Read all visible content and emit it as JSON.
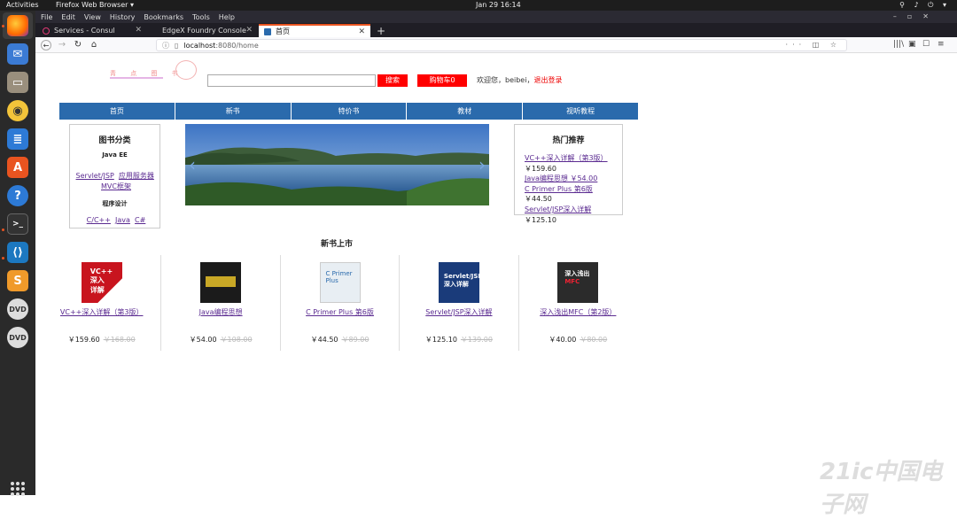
{
  "topbar": {
    "activities": "Activities",
    "app": "Firefox Web Browser ▾",
    "clock": "Jan 29  16:14",
    "system": "⚲ ♪ ⏻ ▾"
  },
  "menubar": [
    "File",
    "Edit",
    "View",
    "History",
    "Bookmarks",
    "Tools",
    "Help"
  ],
  "tabs": [
    {
      "label": "Services - Consul",
      "fav_color": "#e03875"
    },
    {
      "label": "EdgeX Foundry Console",
      "fav_color": "#888888"
    },
    {
      "label": "首页",
      "fav_color": "#2a6aac",
      "active": true
    }
  ],
  "url": {
    "host": "localhost",
    "path": ":8080/home"
  },
  "header": {
    "logo_text": "青 点 图 书",
    "search_placeholder": "",
    "search_button": "搜索",
    "cart_button": "购物车0",
    "welcome": "欢迎您，beibei，",
    "logout": "退出登录"
  },
  "nav": [
    "首页",
    "新书",
    "特价书",
    "教材",
    "视听教程"
  ],
  "categories": {
    "title": "图书分类",
    "group1": "Java EE",
    "group1_links": [
      "Servlet/JSP",
      "应用服务器",
      "MVC框架"
    ],
    "group2": "程序设计",
    "group2_links": [
      "C/C++",
      "Java",
      "C#"
    ]
  },
  "hot": {
    "title": "热门推荐",
    "items": [
      "VC++深入详解（第3版）",
      "￥159.60",
      "Java编程思想 ￥54.00",
      "C Primer Plus 第6版",
      "￥44.50",
      "Servlet/JSP深入详解",
      "￥125.10"
    ]
  },
  "new_books": {
    "title": "新书上市",
    "items": [
      {
        "title": "VC++深入详解（第3版）",
        "price": "￥159.60",
        "old": "￥168.00",
        "cover": "#c8141e"
      },
      {
        "title": "Java编程思想",
        "price": "￥54.00",
        "old": "￥108.00",
        "cover": "#1b1b1b"
      },
      {
        "title": "C Primer Plus 第6版",
        "price": "￥44.50",
        "old": "￥89.00",
        "cover": "#e8eef3"
      },
      {
        "title": "Servlet/JSP深入详解",
        "price": "￥125.10",
        "old": "￥139.00",
        "cover": "#1a3b7a"
      },
      {
        "title": "深入浅出MFC（第2版）",
        "price": "￥40.00",
        "old": "￥80.00",
        "cover": "#2b2b2b"
      }
    ]
  },
  "watermark": "21ic中国电子网"
}
